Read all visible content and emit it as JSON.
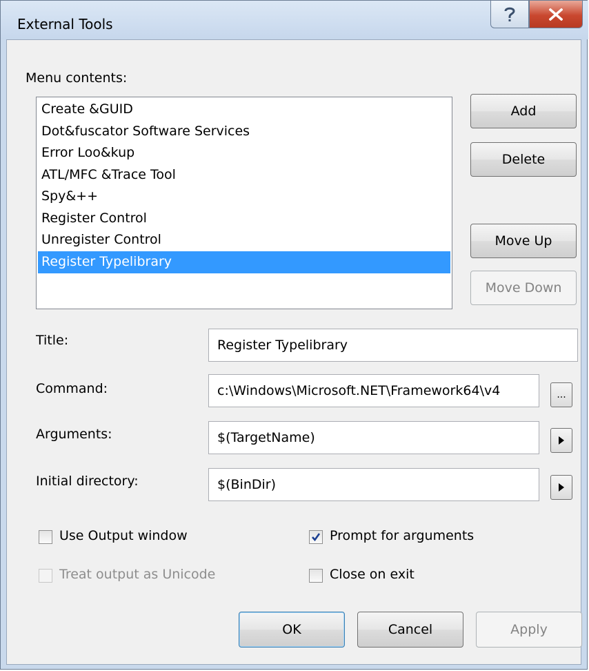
{
  "window": {
    "title": "External Tools"
  },
  "labels": {
    "menu_contents": "Menu contents:",
    "title": "Title:",
    "command": "Command:",
    "arguments": "Arguments:",
    "initial_directory": "Initial directory:"
  },
  "menu_items": [
    "Create &GUID",
    "Dot&fuscator Software Services",
    "Error Loo&kup",
    "ATL/MFC &Trace Tool",
    "Spy&++",
    "Register Control",
    "Unregister Control",
    "Register Typelibrary"
  ],
  "selected_index": 7,
  "side_buttons": {
    "add": "Add",
    "delete": "Delete",
    "move_up": "Move Up",
    "move_down": "Move Down"
  },
  "fields": {
    "title": "Register Typelibrary",
    "command": "c:\\Windows\\Microsoft.NET\\Framework64\\v4",
    "arguments": "$(TargetName)",
    "initial_directory": "$(BinDir)"
  },
  "browse_button": "...",
  "checkboxes": {
    "use_output_window": {
      "label": "Use Output window",
      "checked": false
    },
    "prompt_for_arguments": {
      "label": "Prompt for arguments",
      "checked": true
    },
    "treat_output_unicode": {
      "label": "Treat output as Unicode",
      "checked": false,
      "disabled": true
    },
    "close_on_exit": {
      "label": "Close on exit",
      "checked": false
    }
  },
  "footer_buttons": {
    "ok": "OK",
    "cancel": "Cancel",
    "apply": "Apply"
  },
  "colors": {
    "selection": "#3399ff",
    "window_frame": "#c9d9ec",
    "close_button": "#c9482f"
  }
}
